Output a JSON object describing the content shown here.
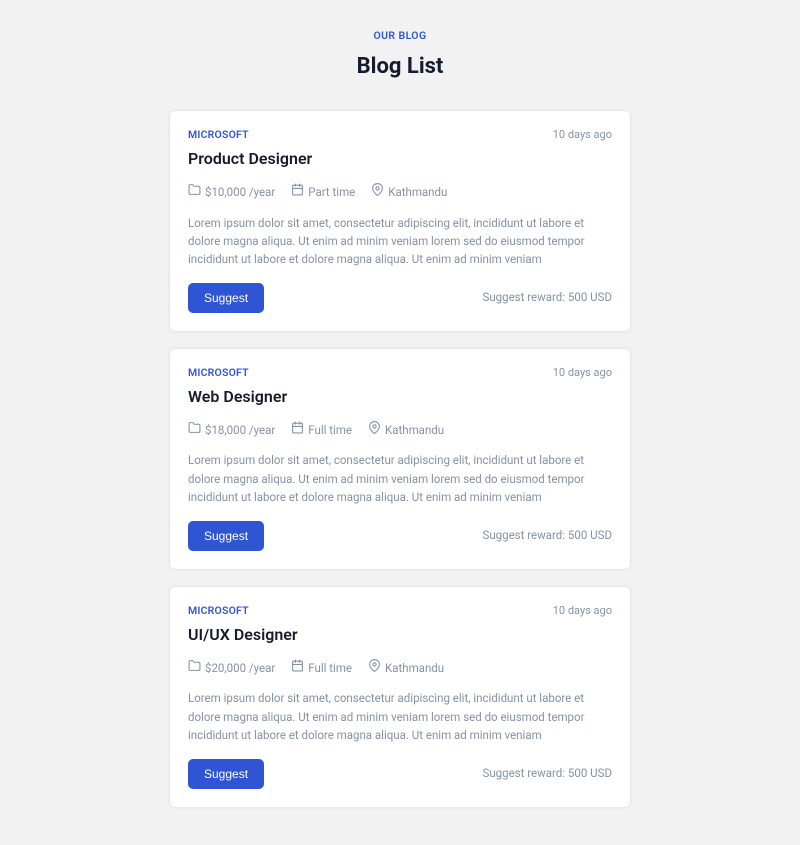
{
  "header": {
    "subtitle": "OUR BLOG",
    "title": "Blog List"
  },
  "posts": [
    {
      "company": "MICROSOFT",
      "timeago": "10 days ago",
      "title": "Product Designer",
      "salary": "$10,000 /year",
      "type": "Part time",
      "location": "Kathmandu",
      "desc": "Lorem ipsum dolor sit amet, consectetur adipiscing elit, incididunt ut labore et dolore magna aliqua. Ut enim ad minim veniam lorem sed do eiusmod tempor incididunt ut labore et dolore magna aliqua. Ut enim ad minim veniam",
      "button": "Suggest",
      "reward": "Suggest reward:  500 USD"
    },
    {
      "company": "MICROSOFT",
      "timeago": "10 days ago",
      "title": "Web Designer",
      "salary": "$18,000 /year",
      "type": "Full time",
      "location": "Kathmandu",
      "desc": "Lorem ipsum dolor sit amet, consectetur adipiscing elit, incididunt ut labore et dolore magna aliqua. Ut enim ad minim veniam lorem sed do eiusmod tempor incididunt ut labore et dolore magna aliqua. Ut enim ad minim veniam",
      "button": "Suggest",
      "reward": "Suggest reward:  500 USD"
    },
    {
      "company": "MICROSOFT",
      "timeago": "10 days ago",
      "title": "UI/UX Designer",
      "salary": "$20,000 /year",
      "type": "Full time",
      "location": "Kathmandu",
      "desc": "Lorem ipsum dolor sit amet, consectetur adipiscing elit, incididunt ut labore et dolore magna aliqua. Ut enim ad minim veniam lorem sed do eiusmod tempor incididunt ut labore et dolore magna aliqua. Ut enim ad minim veniam",
      "button": "Suggest",
      "reward": "Suggest reward:  500 USD"
    }
  ]
}
